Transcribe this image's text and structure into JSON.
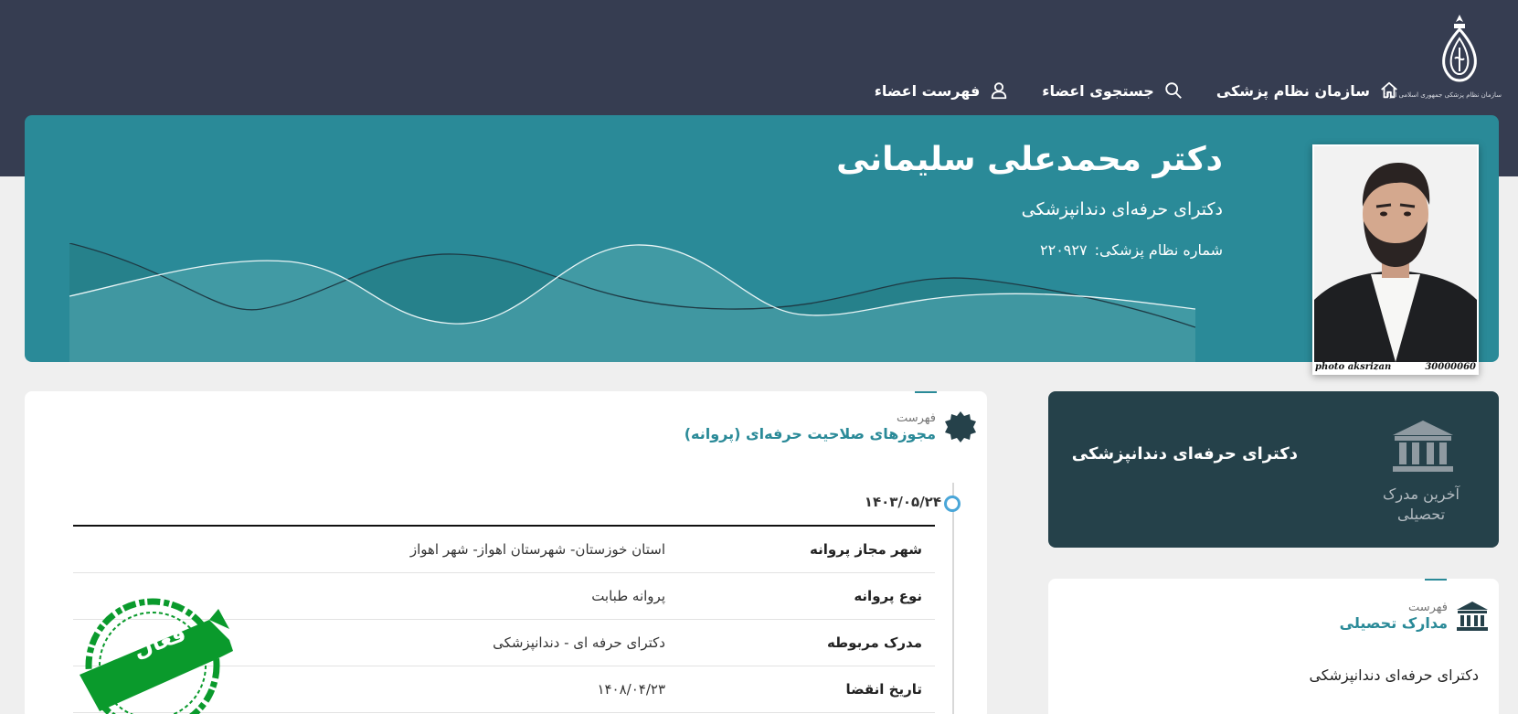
{
  "logo": {
    "icon": "medical-council-emblem-icon",
    "text": "سازمان نظام پزشکی جمهوری اسلامی ایران"
  },
  "nav": {
    "items": [
      {
        "label": "سازمان نظام پزشکی",
        "icon": "home-icon"
      },
      {
        "label": "جستجوی اعضاء",
        "icon": "search-icon"
      },
      {
        "label": "فهرست اعضاء",
        "icon": "user-icon"
      }
    ]
  },
  "profile": {
    "name": "دکتر محمدعلی سلیمانی",
    "specialty": "دکترای حرفه‌ای دندانپزشکی",
    "council_number_label": "شماره نظام پزشکی:",
    "council_number": "۲۲۰۹۲۷",
    "photo_caption_left": "photo aksrizan",
    "photo_caption_right": "30000060"
  },
  "licenses": {
    "heading_small": "فهرست",
    "heading": "مجوزهای صلاحیت حرفه‌ای (پروانه)",
    "date": "۱۴۰۳/۰۵/۲۴",
    "rows": [
      {
        "label": "شهر مجاز پروانه",
        "value": "استان خوزستان- شهرستان اهواز- شهر اهواز"
      },
      {
        "label": "نوع پروانه",
        "value": "پروانه طبابت"
      },
      {
        "label": "مدرک مربوطه",
        "value": "دکترای حرفه ای - دندانپزشکی"
      },
      {
        "label": "تاریخ انقضا",
        "value": "۱۴۰۸/۰۴/۲۳"
      }
    ],
    "status_stamp": "فعال",
    "colors": {
      "stamp": "#0a9a2c",
      "accent": "#2a8a98"
    }
  },
  "last_degree": {
    "label": "آخرین مدرک تحصیلی",
    "value": "دکترای حرفه‌ای دندانپزشکی"
  },
  "degrees": {
    "heading_small": "فهرست",
    "heading": "مدارک تحصیلی",
    "items": [
      "دکترای حرفه‌ای دندانپزشکی"
    ]
  }
}
